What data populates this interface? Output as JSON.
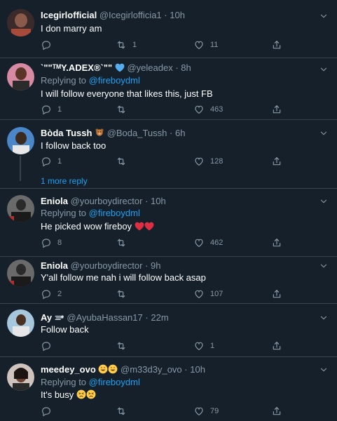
{
  "tweets": [
    {
      "name": "Icegirlofficial",
      "handle": "@Icegirlofficia1",
      "time": "10h",
      "reply_prefix": "",
      "reply_mention": "",
      "text": "I don marry am",
      "counts": {
        "reply": "",
        "retweet": "1",
        "like": "11"
      },
      "avatar_color": "#6b3d3a"
    },
    {
      "name": "`\"\"ᵀᴹY.ADEX®`\"\"",
      "handle": "@yeleadex",
      "time": "8h",
      "reply_prefix": "Replying to",
      "reply_mention": "@fireboydml",
      "text": "I will follow everyone that likes this, just FB",
      "counts": {
        "reply": "1",
        "retweet": "",
        "like": "463"
      },
      "avatar_color": "#c76b88"
    },
    {
      "name": "Bòda Tussh",
      "handle": "@Boda_Tussh",
      "time": "6h",
      "reply_prefix": "",
      "reply_mention": "",
      "text": "I follow back too",
      "counts": {
        "reply": "1",
        "retweet": "",
        "like": "128"
      },
      "more_reply": "1 more reply",
      "avatar_color": "#3e6fa8"
    },
    {
      "name": "Eniola",
      "handle": "@yourboydirector",
      "time": "10h",
      "reply_prefix": "Replying to",
      "reply_mention": "@fireboydml",
      "text": "He picked wow fireboy",
      "counts": {
        "reply": "8",
        "retweet": "",
        "like": "462"
      },
      "avatar_color": "#4a4a4a"
    },
    {
      "name": "Eniola",
      "handle": "@yourboydirector",
      "time": "9h",
      "reply_prefix": "",
      "reply_mention": "",
      "text": "Y'all follow me nah i will follow back asap",
      "counts": {
        "reply": "2",
        "retweet": "",
        "like": "107"
      },
      "avatar_color": "#4a4a4a"
    },
    {
      "name": "Ay",
      "handle": "@AyubaHassan17",
      "time": "22m",
      "reply_prefix": "",
      "reply_mention": "",
      "text": "Follow back",
      "counts": {
        "reply": "",
        "retweet": "",
        "like": "1"
      },
      "avatar_color": "#8fb3c9"
    },
    {
      "name": "meedey_ovo",
      "handle": "@m33d3y_ovo",
      "time": "10h",
      "reply_prefix": "Replying to",
      "reply_mention": "@fireboydml",
      "text": "It's busy",
      "counts": {
        "reply": "",
        "retweet": "",
        "like": "79"
      },
      "avatar_color": "#5a3b32"
    }
  ],
  "colors": {
    "background": "#15202b",
    "separator": "#38444d",
    "muted": "#8899a6",
    "accent": "#1da1f2",
    "heart_red": "#e0245e"
  },
  "icons": [
    "reply-icon",
    "retweet-icon",
    "like-icon",
    "share-icon",
    "caret-down-icon",
    "verified-heart-icon",
    "teddy-bear-icon",
    "dash-icon",
    "red-heart-emoji",
    "smile-emoji",
    "persevere-emoji"
  ]
}
